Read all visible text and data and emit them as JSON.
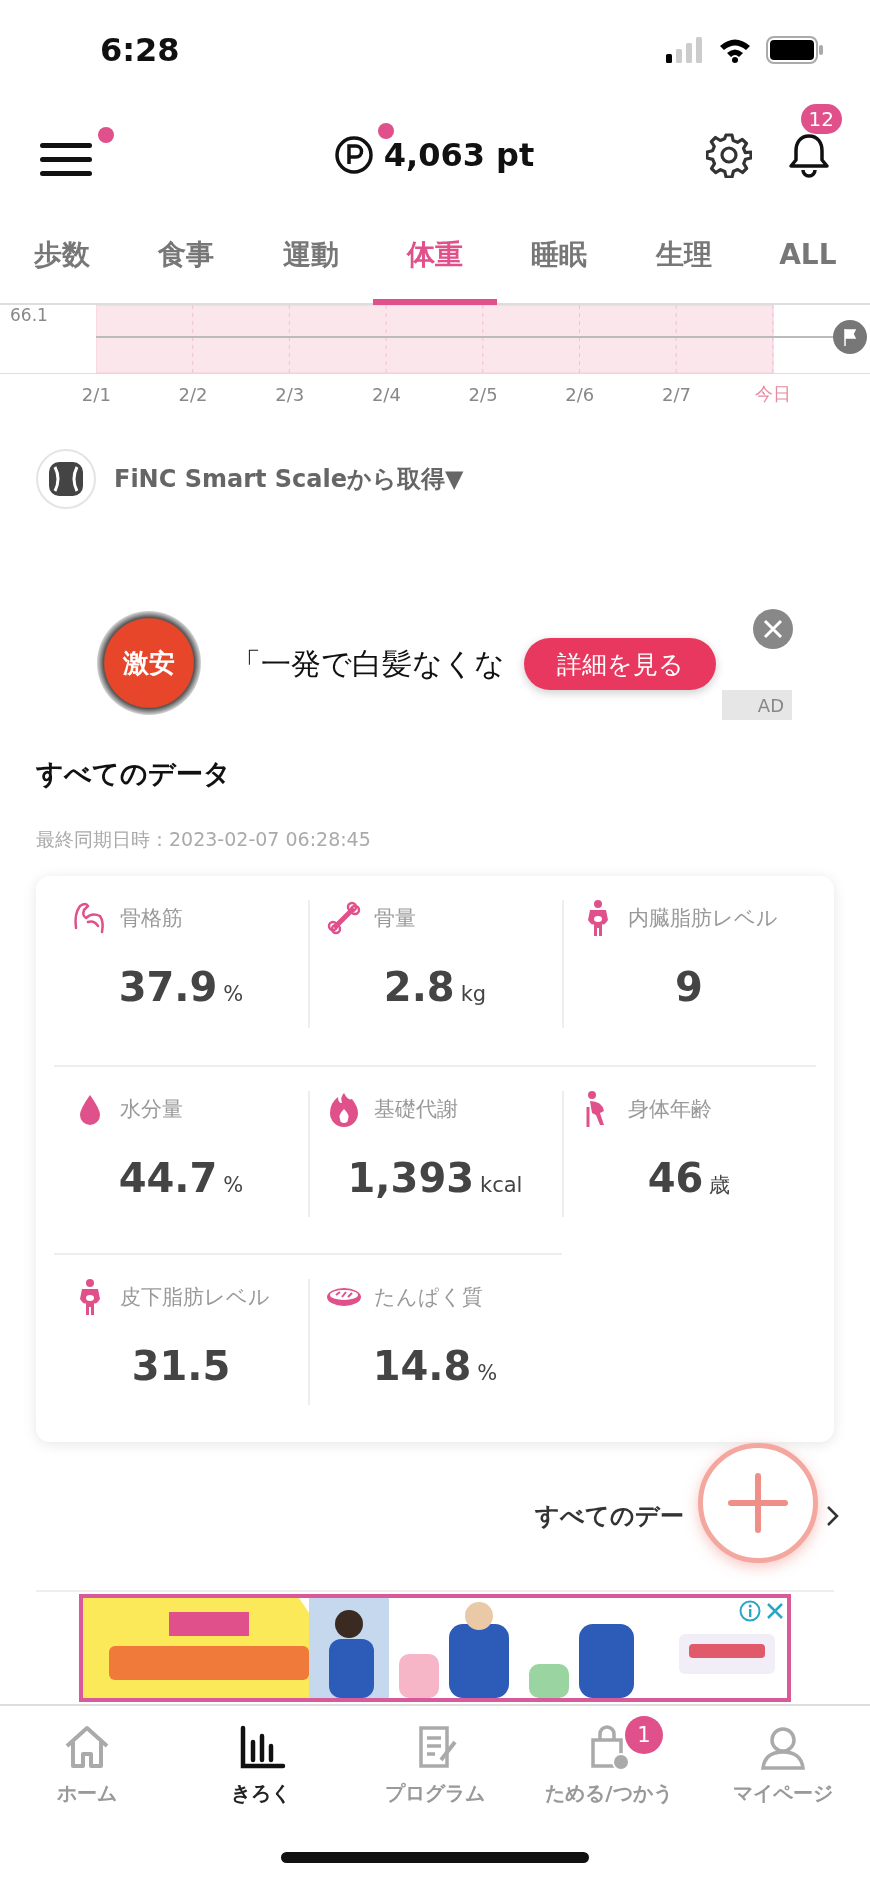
{
  "status_bar": {
    "time": "6:28"
  },
  "header": {
    "menu_dot": true,
    "points": "4,063 pt",
    "points_dot": true,
    "bell_badge": "12"
  },
  "tabs": [
    {
      "label": "歩数",
      "selected": false
    },
    {
      "label": "食事",
      "selected": false
    },
    {
      "label": "運動",
      "selected": false
    },
    {
      "label": "体重",
      "selected": true
    },
    {
      "label": "睡眠",
      "selected": false
    },
    {
      "label": "生理",
      "selected": false
    },
    {
      "label": "ALL",
      "selected": false
    }
  ],
  "chart": {
    "y_label": "66.1",
    "x_labels": [
      {
        "label": "2/1",
        "today": false
      },
      {
        "label": "2/2",
        "today": false
      },
      {
        "label": "2/3",
        "today": false
      },
      {
        "label": "2/4",
        "today": false
      },
      {
        "label": "2/5",
        "today": false
      },
      {
        "label": "2/6",
        "today": false
      },
      {
        "label": "2/7",
        "today": false
      },
      {
        "label": "今日",
        "today": true
      }
    ]
  },
  "source": {
    "label": "FiNC Smart Scaleから取得▼"
  },
  "ad": {
    "badge": "激安",
    "text": "「一発で白髪なくな",
    "button": "詳細を見る",
    "tag": "AD"
  },
  "all_data": {
    "title": "すべてのデータ",
    "synced": "最終同期日時：2023-02-07 06:28:45",
    "items": [
      {
        "label": "骨格筋",
        "value": "37.9",
        "unit": "%"
      },
      {
        "label": "骨量",
        "value": "2.8",
        "unit": "kg"
      },
      {
        "label": "内臓脂肪レベル",
        "value": "9"
      },
      {
        "label": "水分量",
        "value": "44.7",
        "unit": "%"
      },
      {
        "label": "基礎代謝",
        "value": "1,393",
        "unit": "kcal"
      },
      {
        "label": "身体年齢",
        "value": "46",
        "unit": "歳"
      },
      {
        "label": "皮下脂肪レベル",
        "value": "31.5"
      },
      {
        "label": "たんぱく質",
        "value": "14.8",
        "unit": "%"
      }
    ],
    "link": "すべてのデー"
  },
  "nav": [
    {
      "label": "ホーム",
      "selected": false
    },
    {
      "label": "きろく",
      "selected": true
    },
    {
      "label": "プログラム",
      "selected": false
    },
    {
      "label": "ためる/つかう",
      "selected": false,
      "badge": "1"
    },
    {
      "label": "マイページ",
      "selected": false
    }
  ]
}
